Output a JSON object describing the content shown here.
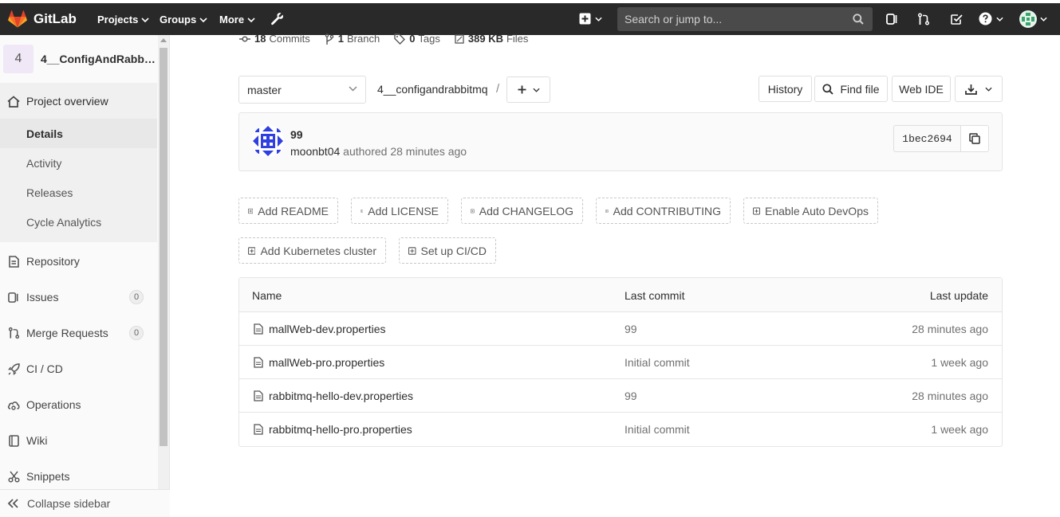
{
  "navbar": {
    "brand": "GitLab",
    "projects": "Projects",
    "groups": "Groups",
    "more": "More",
    "search_placeholder": "Search or jump to..."
  },
  "sidebar": {
    "project_avatar": "4",
    "project_name": "4__ConfigAndRabbitMQ",
    "project_overview": "Project overview",
    "sub_items": [
      "Details",
      "Activity",
      "Releases",
      "Cycle Analytics"
    ],
    "items": [
      {
        "label": "Repository",
        "icon": "repository-icon"
      },
      {
        "label": "Issues",
        "icon": "issues-icon",
        "badge": "0"
      },
      {
        "label": "Merge Requests",
        "icon": "merge-request-icon",
        "badge": "0"
      },
      {
        "label": "CI / CD",
        "icon": "rocket-icon"
      },
      {
        "label": "Operations",
        "icon": "cloud-gear-icon"
      },
      {
        "label": "Wiki",
        "icon": "book-icon"
      },
      {
        "label": "Snippets",
        "icon": "scissors-icon"
      }
    ],
    "collapse": "Collapse sidebar"
  },
  "stats": {
    "commits_count": "18",
    "commits_label": "Commits",
    "branch_count": "1",
    "branch_label": "Branch",
    "tags_count": "0",
    "tags_label": "Tags",
    "files_size": "389 KB",
    "files_label": "Files"
  },
  "repo_nav": {
    "branch": "master",
    "path": "4__configandrabbitmq",
    "separator": "/",
    "history": "History",
    "find_file": "Find file",
    "web_ide": "Web IDE"
  },
  "commit": {
    "title": "99",
    "author": "moonbt04",
    "meta": "authored 28 minutes ago",
    "sha": "1bec2694"
  },
  "actions": {
    "add_readme": "Add README",
    "add_license": "Add LICENSE",
    "add_changelog": "Add CHANGELOG",
    "add_contributing": "Add CONTRIBUTING",
    "enable_auto_devops": "Enable Auto DevOps",
    "add_kubernetes": "Add Kubernetes cluster",
    "setup_cicd": "Set up CI/CD"
  },
  "files": {
    "headers": {
      "name": "Name",
      "last_commit": "Last commit",
      "last_update": "Last update"
    },
    "rows": [
      {
        "name": "mallWeb-dev.properties",
        "commit": "99",
        "updated": "28 minutes ago"
      },
      {
        "name": "mallWeb-pro.properties",
        "commit": "Initial commit",
        "updated": "1 week ago"
      },
      {
        "name": "rabbitmq-hello-dev.properties",
        "commit": "99",
        "updated": "28 minutes ago"
      },
      {
        "name": "rabbitmq-hello-pro.properties",
        "commit": "Initial commit",
        "updated": "1 week ago"
      }
    ]
  },
  "colors": {
    "navbar": "#292929",
    "sidebar": "#fafafa",
    "brand_orange": "#fc6d26"
  }
}
